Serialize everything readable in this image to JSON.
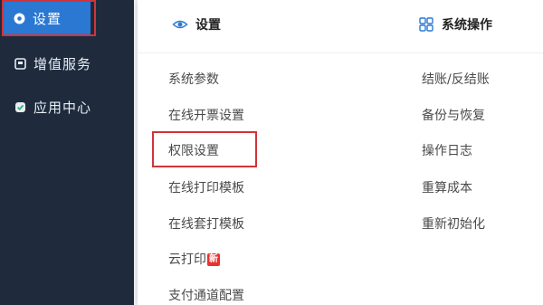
{
  "sidebar": {
    "items": [
      {
        "label": "设置",
        "icon": "eye-icon",
        "active": true
      },
      {
        "label": "增值服务",
        "icon": "square-icon"
      },
      {
        "label": "应用中心",
        "icon": "check-badge-icon"
      }
    ]
  },
  "panel": {
    "settings_header": "设置",
    "ops_header": "系统操作",
    "settings_items": [
      "系统参数",
      "在线开票设置",
      "权限设置",
      "在线打印模板",
      "在线套打模板",
      "云打印",
      "支付通道配置"
    ],
    "new_badge": "新",
    "ops_items": [
      "结账/反结账",
      "备份与恢复",
      "操作日志",
      "重算成本",
      "重新初始化"
    ]
  },
  "colors": {
    "sidebar_bg": "#1f2b3d",
    "active_bg": "#2a78d2",
    "highlight": "#d0343a",
    "badge": "#e8322e"
  }
}
